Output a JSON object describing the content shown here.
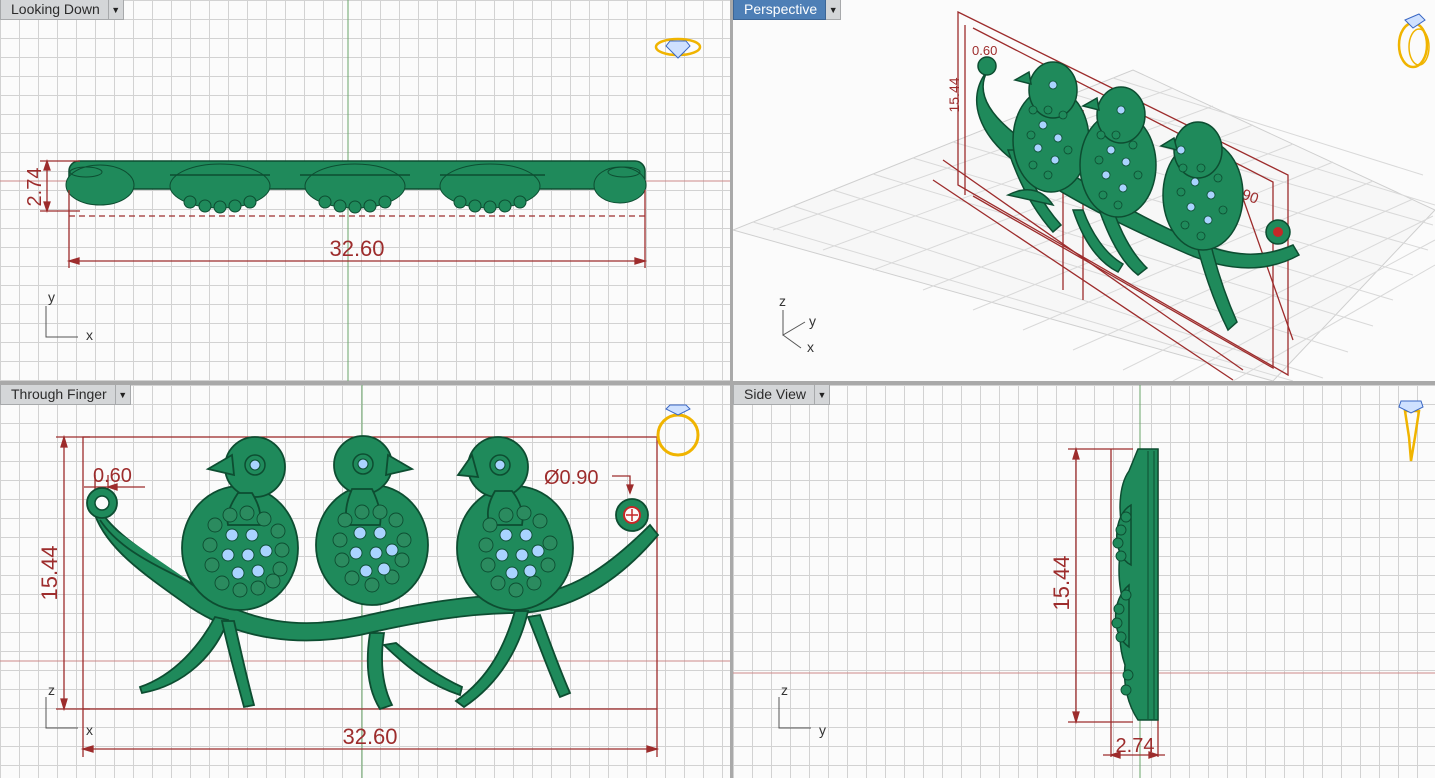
{
  "viewports": {
    "top": {
      "title": "Looking Down",
      "menu_icon": "chevron-down-icon",
      "dimensions": {
        "thickness": "2.74",
        "width": "32.60"
      },
      "axes": {
        "vertical": "y",
        "horizontal": "x"
      },
      "view_icon": "ring-top-view-icon"
    },
    "perspective": {
      "title": "Perspective",
      "menu_icon": "chevron-down-icon",
      "dimensions": {
        "height": "15.44",
        "hole": "0.60",
        "diameter": "Ø0.90"
      },
      "axes": {
        "z": "z",
        "y": "y",
        "x": "x"
      },
      "view_icon": "ring-perspective-icon"
    },
    "front": {
      "title": "Through Finger",
      "menu_icon": "chevron-down-icon",
      "dimensions": {
        "height": "15.44",
        "width": "32.60",
        "hole": "0.60",
        "diameter": "Ø0.90"
      },
      "axes": {
        "vertical": "z",
        "horizontal": "x"
      },
      "view_icon": "ring-front-view-icon"
    },
    "side": {
      "title": "Side View",
      "menu_icon": "chevron-down-icon",
      "dimensions": {
        "height": "15.44",
        "thickness": "2.74"
      },
      "axes": {
        "vertical": "z",
        "horizontal": "y"
      },
      "view_icon": "ring-side-view-icon"
    }
  },
  "colors": {
    "model": "#1f8a5b",
    "model_dark": "#0d4d31",
    "dimension": "#9d2c2c",
    "gem": "#a9d3ff",
    "active_tab": "#4e7fb6"
  }
}
